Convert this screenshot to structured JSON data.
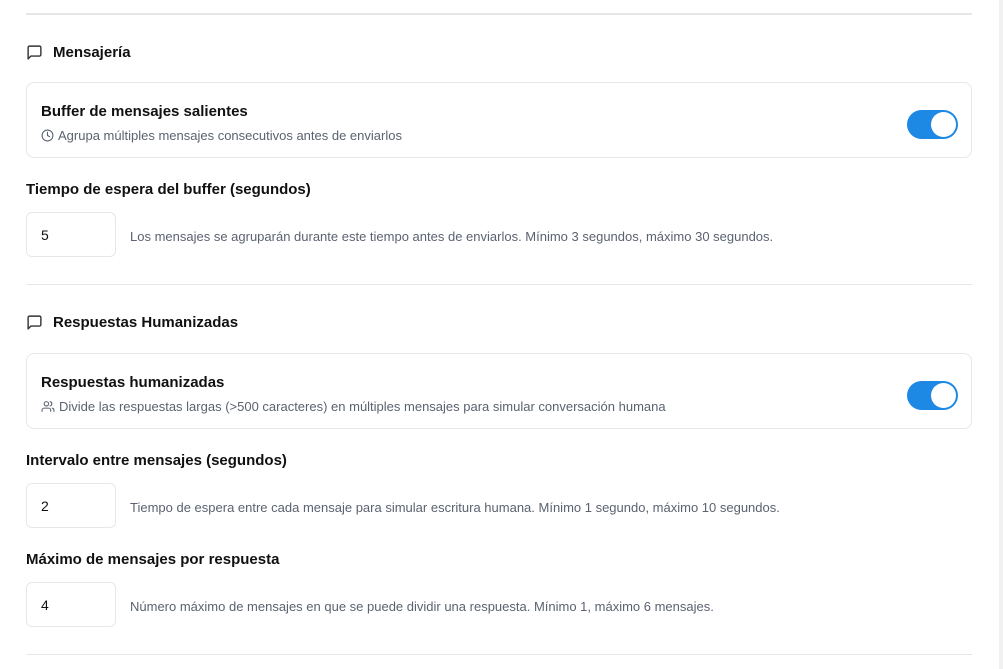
{
  "messaging": {
    "heading": "Mensajería",
    "heading_icon": "message-square-icon",
    "buffer_card": {
      "title": "Buffer de mensajes salientes",
      "description": "Agrupa múltiples mensajes consecutivos antes de enviarlos",
      "description_icon": "clock-icon",
      "enabled": true
    },
    "buffer_timeout": {
      "label": "Tiempo de espera del buffer (segundos)",
      "value": "5",
      "hint": "Los mensajes se agruparán durante este tiempo antes de enviarlos. Mínimo 3 segundos, máximo 30 segundos."
    }
  },
  "humanized": {
    "heading": "Respuestas Humanizadas",
    "heading_icon": "message-square-icon",
    "card": {
      "title": "Respuestas humanizadas",
      "description": "Divide las respuestas largas (>500 caracteres) en múltiples mensajes para simular conversación humana",
      "description_icon": "users-icon",
      "enabled": true
    },
    "interval": {
      "label": "Intervalo entre mensajes (segundos)",
      "value": "2",
      "hint": "Tiempo de espera entre cada mensaje para simular escritura humana. Mínimo 1 segundo, máximo 10 segundos."
    },
    "max_messages": {
      "label": "Máximo de mensajes por respuesta",
      "value": "4",
      "hint": "Número máximo de mensajes en que se puede dividir una respuesta. Mínimo 1, máximo 6 mensajes."
    }
  },
  "colors": {
    "toggle_on": "#1e88e5",
    "muted_text": "#5b6270",
    "border": "#e5e7eb"
  }
}
